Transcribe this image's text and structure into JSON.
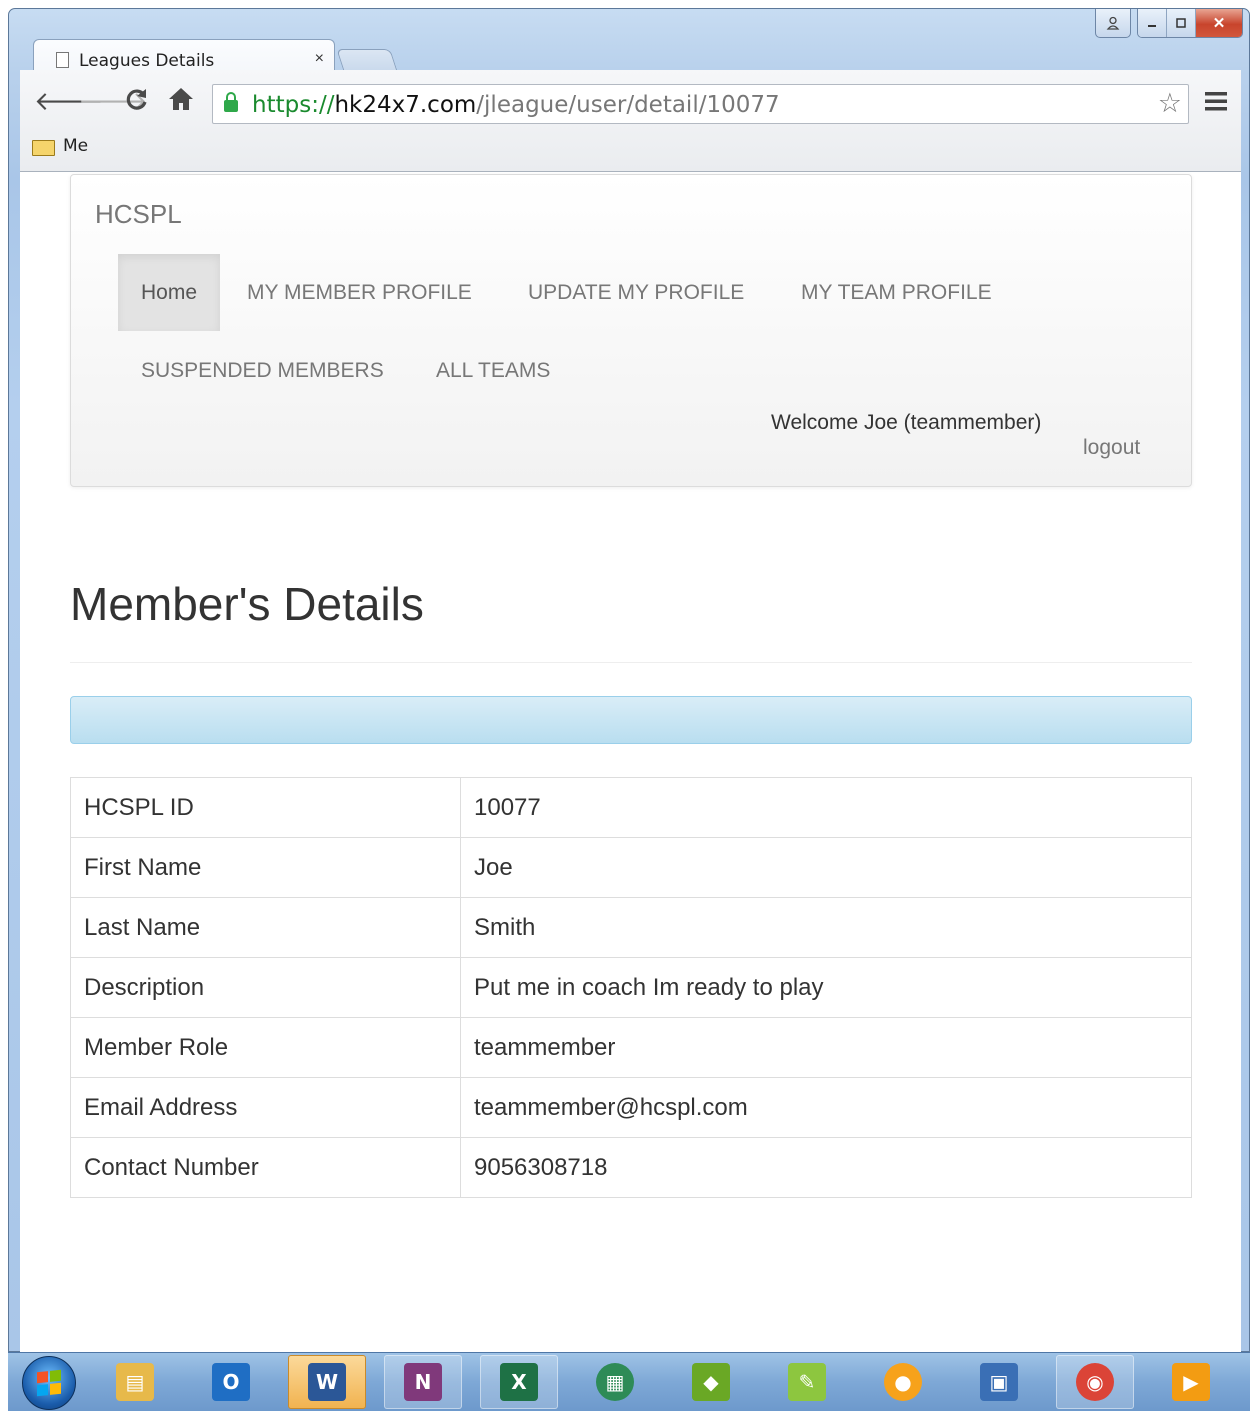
{
  "browser": {
    "tab_title": "Leagues Details",
    "tab_close": "×",
    "url_scheme": "https://",
    "url_host": "hk24x7.com",
    "url_path": "/jleague/user/detail/10077",
    "bookmark_folder": "Me",
    "icons": {
      "back": "back-arrow-icon",
      "forward": "forward-arrow-icon",
      "reload": "reload-icon",
      "home": "home-icon",
      "lock": "lock-icon",
      "star": "star-icon",
      "menu": "hamburger-menu-icon"
    },
    "colors": {
      "secure_green": "#1a8a2e"
    }
  },
  "navbar": {
    "brand": "HCSPL",
    "items": [
      {
        "label": "Home",
        "active": true
      },
      {
        "label": "MY MEMBER PROFILE",
        "active": false
      },
      {
        "label": "UPDATE MY PROFILE",
        "active": false
      },
      {
        "label": "MY TEAM PROFILE",
        "active": false
      },
      {
        "label": "SUSPENDED MEMBERS",
        "active": false
      },
      {
        "label": "ALL TEAMS",
        "active": false
      }
    ],
    "welcome": "Welcome Joe (teammember)",
    "logout": "logout"
  },
  "main": {
    "title": "Member's Details",
    "details": [
      {
        "label": "HCSPL ID",
        "value": "10077"
      },
      {
        "label": "First Name",
        "value": "Joe"
      },
      {
        "label": "Last Name",
        "value": "Smith"
      },
      {
        "label": "Description",
        "value": "Put me in coach Im ready to play"
      },
      {
        "label": "Member Role",
        "value": "teammember"
      },
      {
        "label": "Email Address",
        "value": "teammember@hcspl.com"
      },
      {
        "label": "Contact Number",
        "value": "9056308718"
      }
    ],
    "colors": {
      "alert_bg": "#d9edf7",
      "alert_border": "#9acfea"
    }
  },
  "taskbar": {
    "apps": [
      {
        "name": "windows-explorer-icon",
        "glyph": "▤",
        "color": "#e7b94a",
        "state": "pinned"
      },
      {
        "name": "outlook-icon",
        "glyph": "O",
        "color": "#1f6ec4",
        "state": "pinned"
      },
      {
        "name": "word-icon",
        "glyph": "W",
        "color": "#2b5797",
        "state": "highlighted"
      },
      {
        "name": "onenote-icon",
        "glyph": "N",
        "color": "#80397b",
        "state": "open"
      },
      {
        "name": "excel-icon",
        "glyph": "X",
        "color": "#1e7145",
        "state": "open"
      },
      {
        "name": "calculator-app-icon",
        "glyph": "▦",
        "color": "#2e8b57",
        "state": "pinned"
      },
      {
        "name": "chameleon-app-icon",
        "glyph": "◆",
        "color": "#6aa825",
        "state": "pinned"
      },
      {
        "name": "notepad-plus-icon",
        "glyph": "✎",
        "color": "#8dc63f",
        "state": "pinned"
      },
      {
        "name": "orange-app-icon",
        "glyph": "●",
        "color": "#f7a21b",
        "state": "pinned"
      },
      {
        "name": "remote-desktop-icon",
        "glyph": "▣",
        "color": "#3a6fb5",
        "state": "pinned"
      },
      {
        "name": "chrome-icon",
        "glyph": "◉",
        "color": "#db4437",
        "state": "open"
      },
      {
        "name": "media-player-icon",
        "glyph": "▶",
        "color": "#f39c12",
        "state": "pinned"
      }
    ]
  }
}
